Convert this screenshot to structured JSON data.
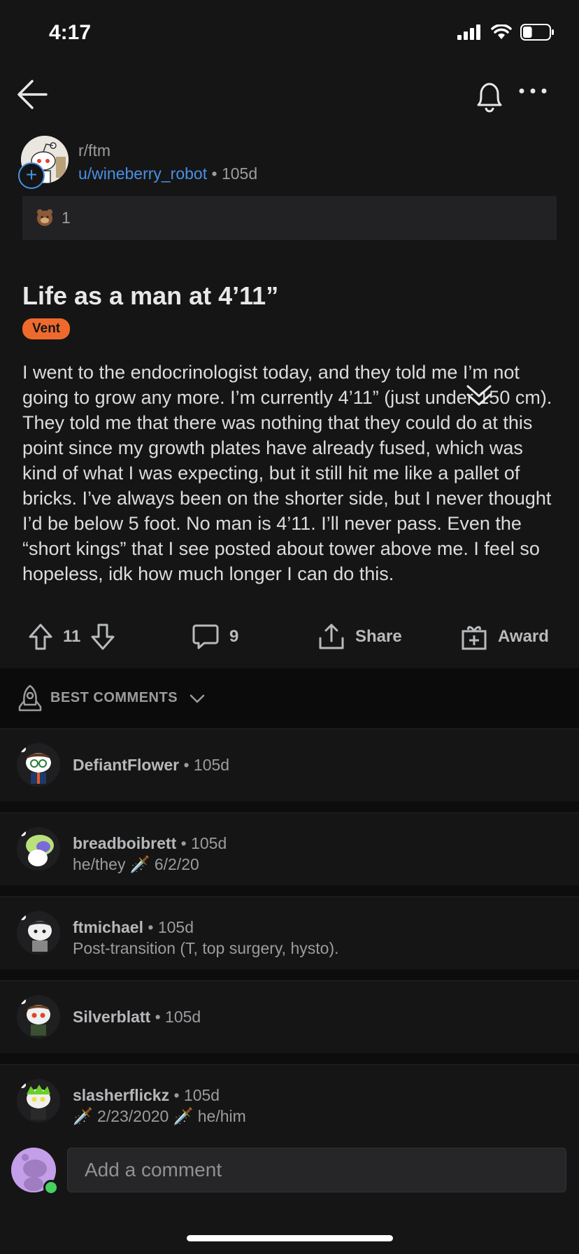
{
  "status_bar": {
    "time": "4:17",
    "battery_level": 0.35
  },
  "post": {
    "subreddit": "r/ftm",
    "author": "u/wineberry_robot",
    "separator": "•",
    "age": "105d",
    "award_count": "1",
    "title": "Life as a man at 4’11”",
    "flair": "Vent",
    "body": "I went to the endocrinologist today, and they told me I’m not going to grow any more. I’m currently 4’11” (just under 150 cm). They told me that there was nothing that they could do at this point since my growth plates have already fused, which was kind of what I was expecting, but it still hit me like a pallet of bricks. I’ve always been on the shorter side, but I never thought I’d be below 5 foot. No man is 4’11. I’ll never pass. Even the “short kings” that I see posted about tower above me. I feel so hopeless, idk how much longer I can do this."
  },
  "actions": {
    "votes": "11",
    "comments": "9",
    "share": "Share",
    "award": "Award"
  },
  "sort": {
    "label": "BEST COMMENTS"
  },
  "comments": [
    {
      "user": "DefiantFlower",
      "age": "• 105d",
      "flair": ""
    },
    {
      "user": "breadboibrett",
      "age": "• 105d",
      "flair": "he/they 🗡️ 6/2/20"
    },
    {
      "user": "ftmichael",
      "age": "• 105d",
      "flair": "Post-transition (T, top surgery, hysto)."
    },
    {
      "user": "Silverblatt",
      "age": "• 105d",
      "flair": ""
    },
    {
      "user": "slasherflickz",
      "age": "• 105d",
      "flair": "🗡️ 2/23/2020 🗡️  he/him"
    }
  ],
  "composer": {
    "placeholder": "Add a comment"
  },
  "colors": {
    "accent_blue": "#4a90e2",
    "flair_orange": "#ee6a2c",
    "online_green": "#46d160",
    "background": "#151516"
  },
  "icons": [
    "back-arrow-icon",
    "bell-icon",
    "more-icon",
    "upvote-icon",
    "downvote-icon",
    "comment-icon",
    "share-icon",
    "award-icon",
    "rocket-icon",
    "chevron-down-icon"
  ]
}
